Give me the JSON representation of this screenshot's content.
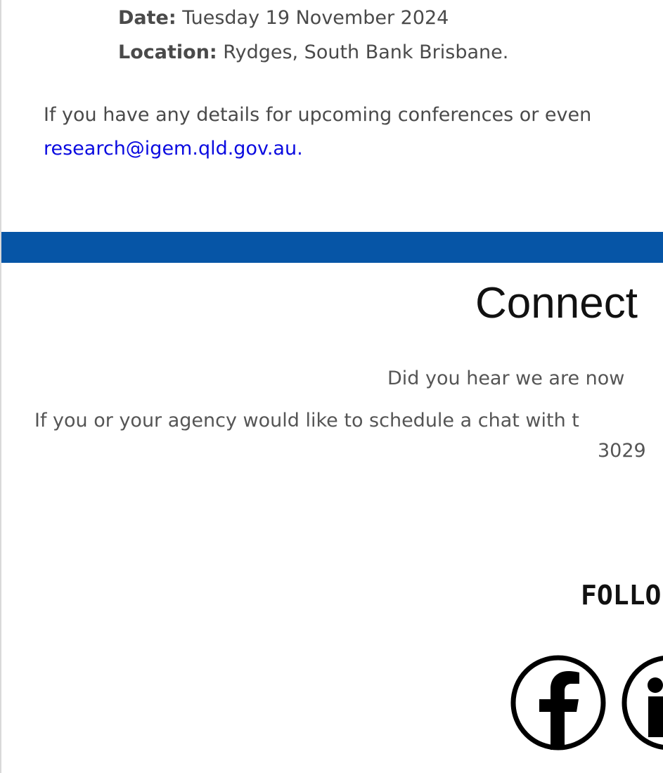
{
  "event": {
    "date_label": "Date:",
    "date_value": " Tuesday 19 November 2024",
    "location_label": "Location:",
    "location_value": " Rydges, South Bank Brisbane."
  },
  "contact": {
    "line1": "If you have any details for upcoming conferences or even",
    "email": "research@igem.qld.gov.au."
  },
  "connect": {
    "heading": "Connect",
    "hear_text": "Did you hear we are now",
    "schedule_text": "If you or your agency would like to schedule a chat with t",
    "phone_fragment": "3029"
  },
  "follow": {
    "label": "FOLLO",
    "icons": [
      "facebook-icon",
      "linkedin-icon"
    ]
  },
  "colors": {
    "banner": "#0655a6",
    "link": "#0a0ae0",
    "text": "#4a4a4a"
  }
}
